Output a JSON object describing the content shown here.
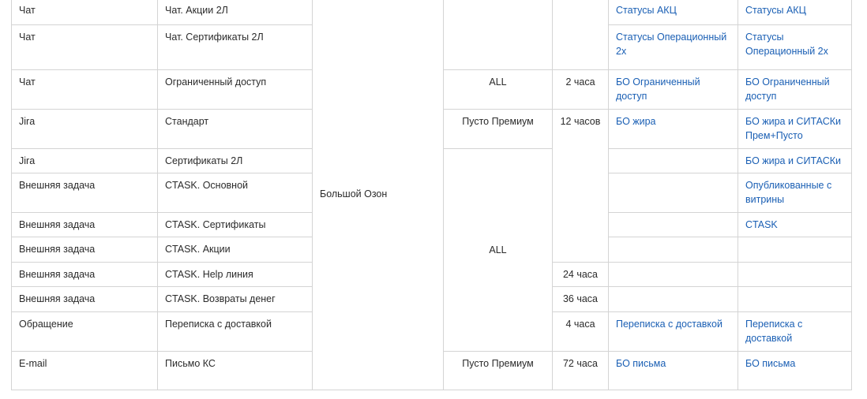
{
  "rows": [
    {
      "type": "Чат",
      "name": "Чат. Акции 2Л",
      "link1": "Статусы АКЦ",
      "link2": "Статусы АКЦ"
    },
    {
      "type": "Чат",
      "name": "Чат. Сертификаты 2Л",
      "link1": "Статусы Операционный 2х",
      "link2": "Статусы Операционный 2х"
    },
    {
      "type": "Чат",
      "name": "Ограниченный доступ",
      "segment": "ALL",
      "time": "2 часа",
      "link1": "БО Ограниченный доступ",
      "link2": "БО Ограниченный доступ"
    },
    {
      "type": "Jira",
      "name": "Стандарт",
      "segment": "Пусто Премиум",
      "time": "12 часов",
      "link1": "БО жира",
      "link2": "БО жира и СИТАСКи Прем+Пусто"
    },
    {
      "type": "Jira",
      "name": "Сертификаты 2Л",
      "link2": "БО жира и СИТАСКи"
    },
    {
      "type": "Внешняя задача",
      "name": "CTASK. Основной",
      "link2": "Опубликованные с витрины"
    },
    {
      "type": "Внешняя задача",
      "name": "CTASK. Сертификаты",
      "link2": "CTASK"
    },
    {
      "type": "Внешняя задача",
      "name": "CTASK. Акции"
    },
    {
      "type": "Внешняя задача",
      "name": "CTASK. Help линия",
      "time": "24 часа"
    },
    {
      "type": "Внешняя задача",
      "name": "CTASK. Возвраты денег",
      "time": "36 часа"
    },
    {
      "type": "Обращение",
      "name": "Переписка с доставкой",
      "time": "4 часа",
      "link1": "Переписка с доставкой",
      "link2": "Переписка с доставкой"
    },
    {
      "type": "E-mail",
      "name": "Письмо КС",
      "segment": "Пусто Премиум",
      "time": "72 часа",
      "link1": "БО письма",
      "link2": "БО письма"
    }
  ],
  "merged": {
    "project": "Большой Озон",
    "segment_all": "ALL"
  }
}
